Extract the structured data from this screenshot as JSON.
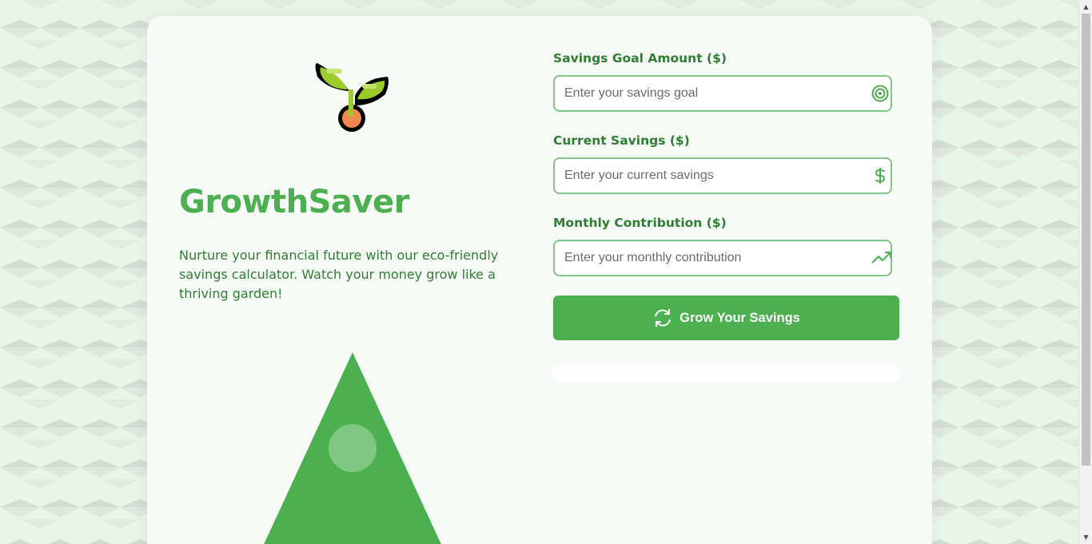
{
  "app": {
    "brand": "GrowthSaver",
    "tagline": "Nurture your financial future with our eco-friendly savings calculator. Watch your money grow like a thriving garden!"
  },
  "form": {
    "goal": {
      "label": "Savings Goal Amount ($)",
      "placeholder": "Enter your savings goal",
      "value": "",
      "icon": "target-icon"
    },
    "current": {
      "label": "Current Savings ($)",
      "placeholder": "Enter your current savings",
      "value": "",
      "icon": "dollar-icon"
    },
    "monthly": {
      "label": "Monthly Contribution ($)",
      "placeholder": "Enter your monthly contribution",
      "value": "",
      "icon": "trending-up-icon"
    },
    "submit": {
      "label": "Grow Your Savings",
      "icon": "refresh-icon"
    }
  },
  "colors": {
    "primary": "#4caf50",
    "dark_green": "#2e7d32",
    "light_green": "#81c784",
    "background": "#e8f5e9",
    "card": "#f7fbf7"
  }
}
